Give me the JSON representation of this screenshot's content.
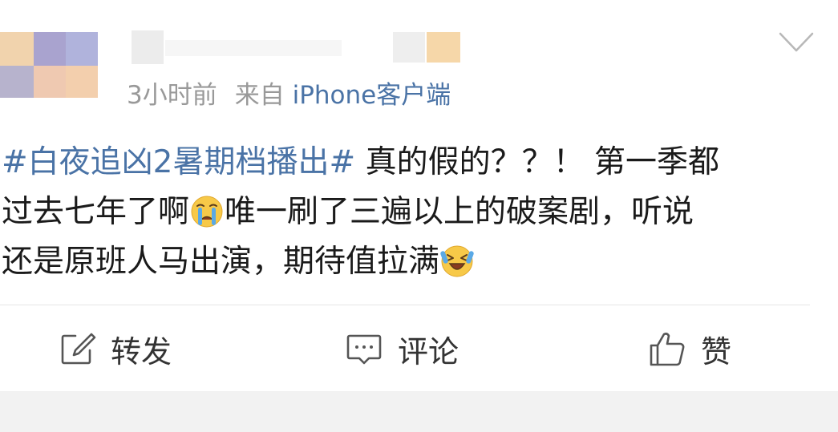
{
  "post": {
    "time": "3小时前",
    "source_prefix": "来自",
    "source": "iPhone客户端",
    "hashtag": "#白夜追凶2暑期档播出#",
    "line1_text": " 真的假的？？！ 第一季都",
    "line2_a": "过去七年了啊",
    "line2_b": "唯一刷了三遍以上的破案剧，听说",
    "line3_a": "还是原班人马出演，期待值拉满",
    "emoji_1": "crying-face-icon",
    "emoji_2": "laughing-tears-face-icon"
  },
  "actions": {
    "repost_label": "转发",
    "comment_label": "评论",
    "like_label": "赞"
  },
  "colors": {
    "link": "#4a73a6",
    "meta": "#999999",
    "text": "#1a1a1a",
    "footer_bg": "#f2f2f2"
  }
}
